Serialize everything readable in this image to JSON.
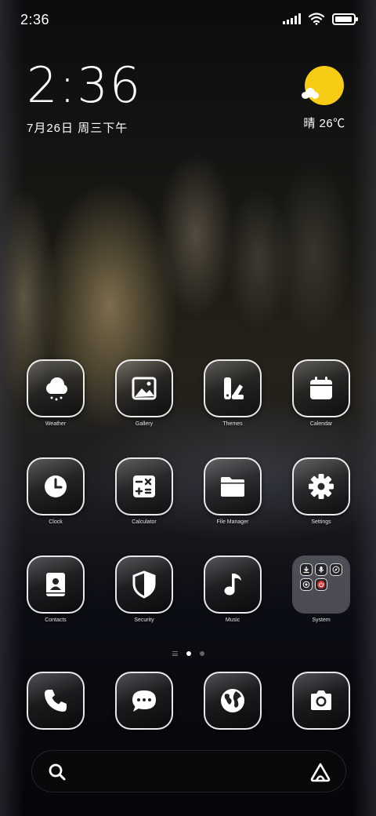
{
  "status_bar": {
    "time": "2:36",
    "icons": [
      "signal-icon",
      "wifi-icon",
      "battery-icon"
    ],
    "battery_level": 0.95
  },
  "clock_widget": {
    "time": "2:36",
    "date": "7月26日 周三下午"
  },
  "weather_widget": {
    "icon": "sun-cloud-icon",
    "text": "晴 26℃",
    "sun_color": "#f8cb14"
  },
  "apps": [
    {
      "label": "Weather",
      "icon": "cloud-rain-icon"
    },
    {
      "label": "Gallery",
      "icon": "image-icon"
    },
    {
      "label": "Themes",
      "icon": "brush-icon"
    },
    {
      "label": "Calendar",
      "icon": "calendar-icon"
    },
    {
      "label": "Clock",
      "icon": "clock-icon"
    },
    {
      "label": "Calculator",
      "icon": "calculator-icon"
    },
    {
      "label": "File Manager",
      "icon": "folder-icon"
    },
    {
      "label": "Settings",
      "icon": "gear-icon"
    },
    {
      "label": "Contacts",
      "icon": "contacts-book-icon"
    },
    {
      "label": "Security",
      "icon": "shield-icon"
    },
    {
      "label": "Music",
      "icon": "music-note-icon"
    },
    {
      "label": "System",
      "icon": "folder-group-icon"
    }
  ],
  "system_folder_icons": [
    "download-icon",
    "microphone-icon",
    "compass-icon",
    "scan-icon",
    "power-icon"
  ],
  "pager": {
    "pages": 2,
    "active": 0
  },
  "dock": [
    {
      "icon": "phone-icon"
    },
    {
      "icon": "message-icon"
    },
    {
      "icon": "globe-icon"
    },
    {
      "icon": "camera-icon"
    }
  ],
  "search_bar": {
    "icons": [
      "search-icon",
      "assistant-icon"
    ]
  }
}
